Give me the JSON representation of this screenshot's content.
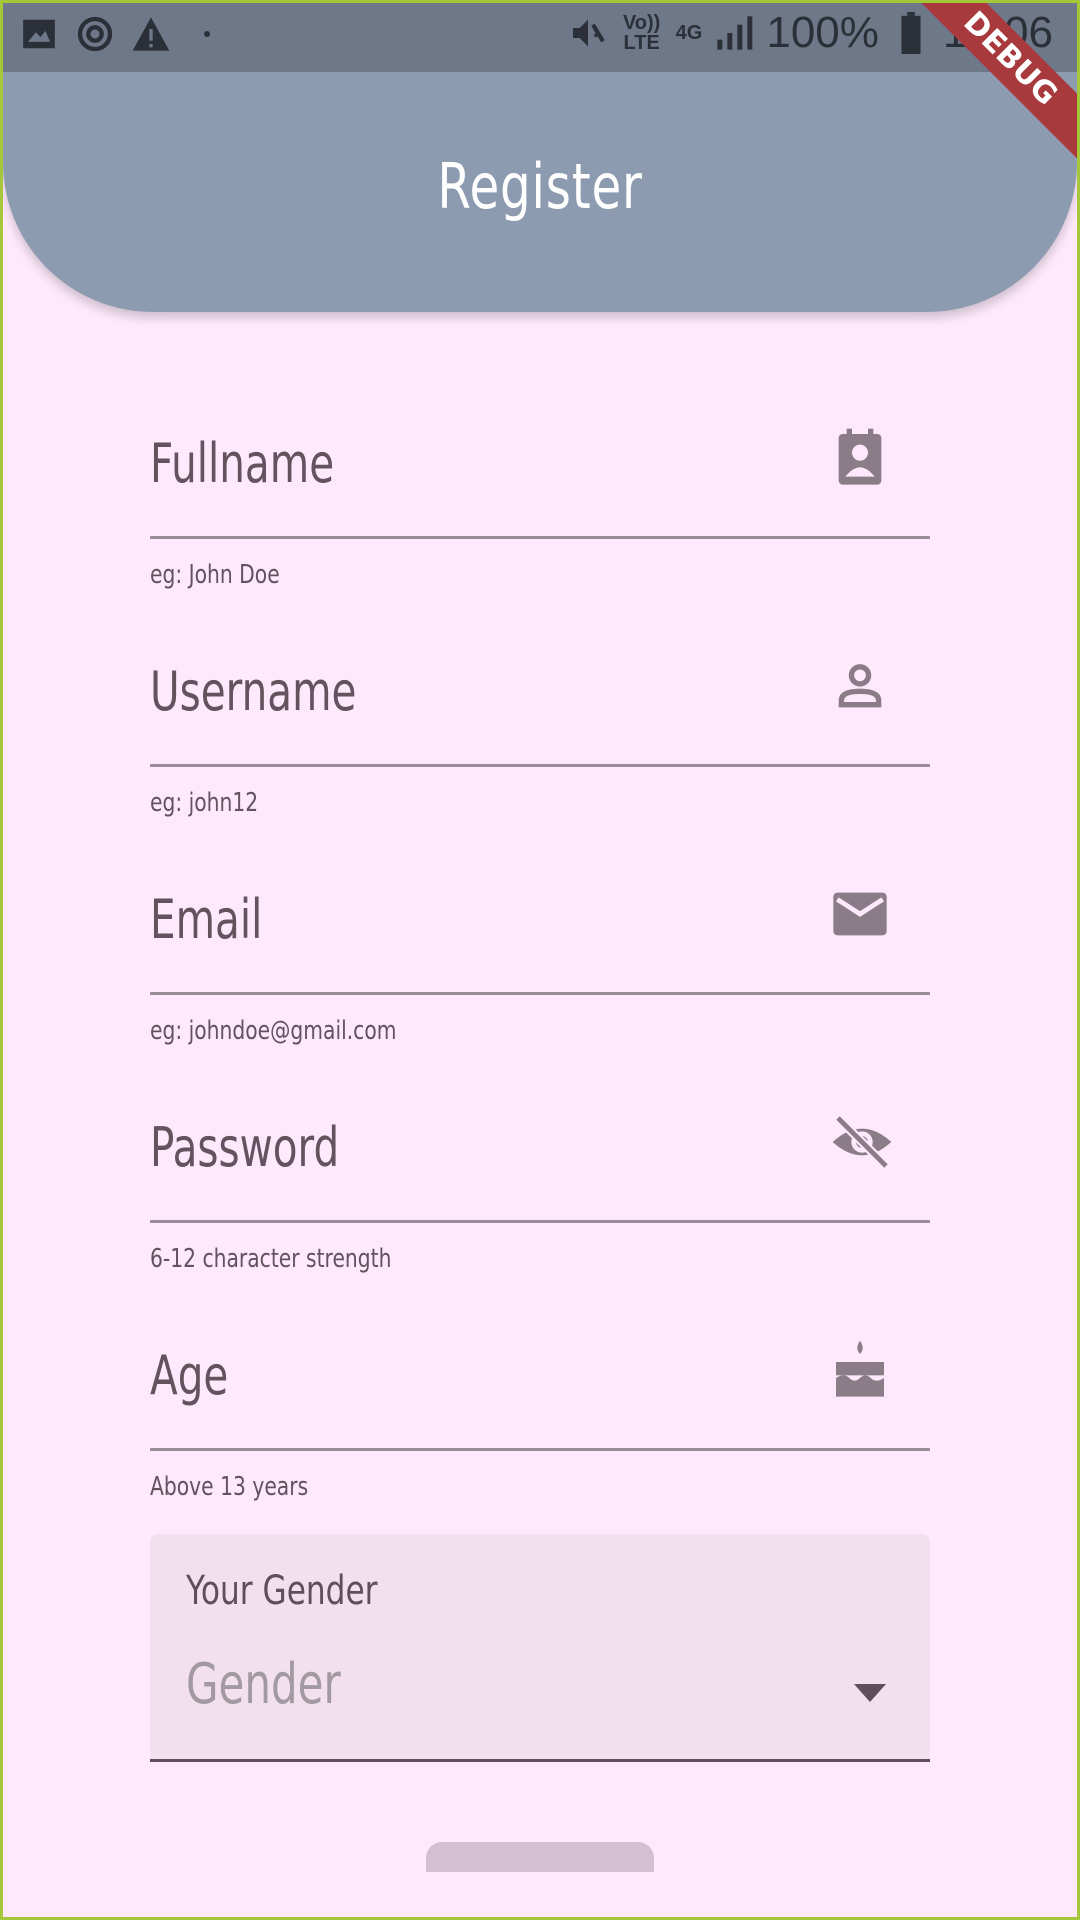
{
  "status_bar": {
    "network_type": "4G",
    "volte": "Vo)) LTE",
    "battery": "100%",
    "time": "12:06"
  },
  "app_bar": {
    "title": "Register"
  },
  "debug_banner": "DEBUG",
  "form": {
    "fields": [
      {
        "label": "Fullname",
        "helper": "eg: John Doe",
        "icon": "contact-card-icon"
      },
      {
        "label": "Username",
        "helper": "eg: john12",
        "icon": "person-outline-icon"
      },
      {
        "label": "Email",
        "helper": "eg: johndoe@gmail.com",
        "icon": "mail-icon"
      },
      {
        "label": "Password",
        "helper": "6-12 character strength",
        "icon": "visibility-off-icon"
      },
      {
        "label": "Age",
        "helper": "Above 13 years",
        "icon": "cake-icon"
      }
    ],
    "gender": {
      "label": "Your Gender",
      "placeholder": "Gender"
    }
  },
  "colors": {
    "background": "#fde9fb",
    "app_bar": "#8d9bb0",
    "text": "#62535f",
    "debug": "#a83a3d"
  }
}
